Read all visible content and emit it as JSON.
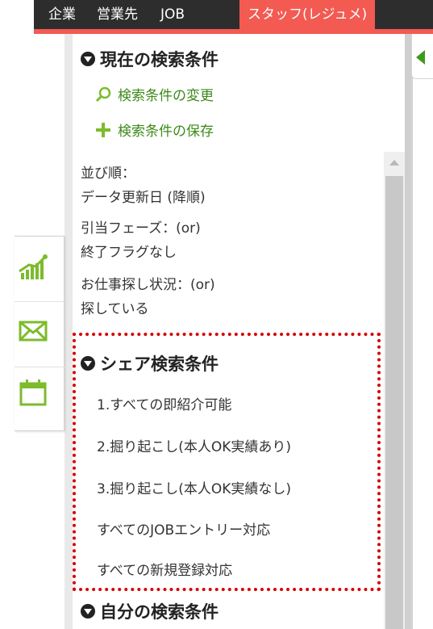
{
  "nav": {
    "tabs": [
      {
        "label": "企業"
      },
      {
        "label": "営業先"
      },
      {
        "label": "JOB"
      },
      {
        "label": "スタッフ(レジュメ)",
        "active": true
      }
    ]
  },
  "current_conditions": {
    "title": "現在の検索条件",
    "change_label": "検索条件の変更",
    "save_label": "検索条件の保存",
    "sort_label": "並び順：",
    "sort_value": "データ更新日 (降順)",
    "phase_label": "引当フェーズ：(or)",
    "phase_value": "終了フラグなし",
    "job_search_label": "お仕事探し状況：(or)",
    "job_search_value": "探している"
  },
  "shared_conditions": {
    "title": "シェア検索条件",
    "items": [
      "1.すべての即紹介可能",
      "2.掘り起こし(本人OK実績あり)",
      "3.掘り起こし(本人OK実績なし)",
      "すべてのJOBエントリー対応",
      "すべての新規登録対応"
    ]
  },
  "my_conditions": {
    "title": "自分の検索条件"
  },
  "dock": {
    "icons": [
      "chart-icon",
      "mail-icon",
      "calendar-icon"
    ]
  },
  "colors": {
    "nav_bg": "#2d2d2d",
    "accent": "#f25a52",
    "green": "#3d8a1a",
    "highlight_border": "#d60000"
  }
}
